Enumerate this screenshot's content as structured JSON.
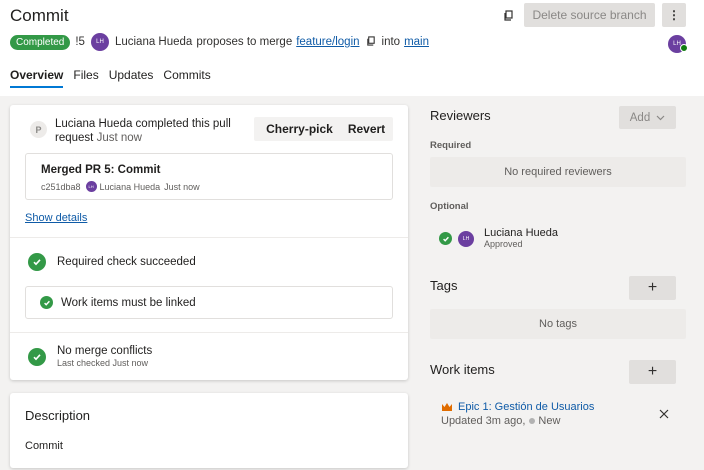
{
  "header": {
    "title": "Commit",
    "delete_branch_label": "Delete source branch",
    "more_label": "⋮",
    "status_label": "Completed",
    "pr_id": "!5",
    "author_initials": "LH",
    "author_name": "Luciana Hueda",
    "proposes_text": "proposes to merge",
    "source_branch": "feature/login",
    "into_text": "into",
    "target_branch": "main"
  },
  "tabs": [
    "Overview",
    "Files",
    "Updates",
    "Commits"
  ],
  "activity": {
    "icon_letter": "P",
    "text": "Luciana Hueda completed this pull request",
    "time": "Just now",
    "cherry_pick_label": "Cherry-pick",
    "revert_label": "Revert"
  },
  "merge": {
    "title": "Merged PR 5: Commit",
    "commit_hash": "c251dba8",
    "author_initials": "LH",
    "author": "Luciana Hueda",
    "time": "Just now"
  },
  "show_details_label": "Show details",
  "checks": {
    "required_check": "Required check succeeded",
    "work_items_linked": "Work items must be linked",
    "merge_conflicts": "No merge conflicts",
    "merge_conflicts_sub": "Last checked Just now"
  },
  "description": {
    "heading": "Description",
    "body": "Commit"
  },
  "reviewers": {
    "heading": "Reviewers",
    "add_label": "Add",
    "required_label": "Required",
    "no_required": "No required reviewers",
    "optional_label": "Optional",
    "reviewer_initials": "LH",
    "reviewer_name": "Luciana Hueda",
    "reviewer_status": "Approved"
  },
  "tags": {
    "heading": "Tags",
    "add_label": "+",
    "empty": "No tags"
  },
  "work_items": {
    "heading": "Work items",
    "add_label": "+",
    "item_title": "Epic 1: Gestión de Usuarios",
    "item_updated": "Updated 3m ago,",
    "item_state": "New"
  },
  "colors": {
    "accent": "#0078d4",
    "success": "#339947",
    "avatar": "#6b3fa0",
    "link": "#0f5ba7",
    "epic": "#e06c00"
  },
  "icons": [
    "copy-icon",
    "more-icon",
    "pull-request-icon",
    "check-icon",
    "chevron-down-icon",
    "plus-icon",
    "crown-icon",
    "close-icon"
  ]
}
